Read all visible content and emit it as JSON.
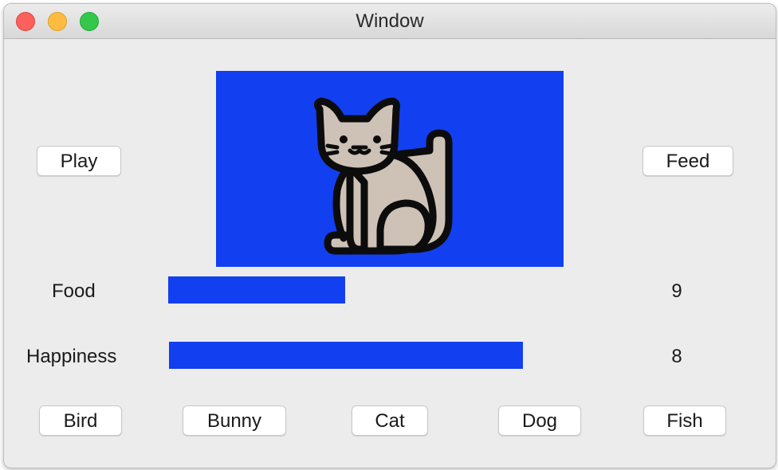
{
  "window": {
    "title": "Window"
  },
  "buttons": {
    "play": "Play",
    "feed": "Feed"
  },
  "pet": {
    "image_icon": "cat-icon",
    "background_color": "#1240f0"
  },
  "stats": {
    "food": {
      "label": "Food",
      "value": "9",
      "level": 0.5
    },
    "happiness": {
      "label": "Happiness",
      "value": "8",
      "level": 1.0
    }
  },
  "pets": [
    "Bird",
    "Bunny",
    "Cat",
    "Dog",
    "Fish"
  ]
}
